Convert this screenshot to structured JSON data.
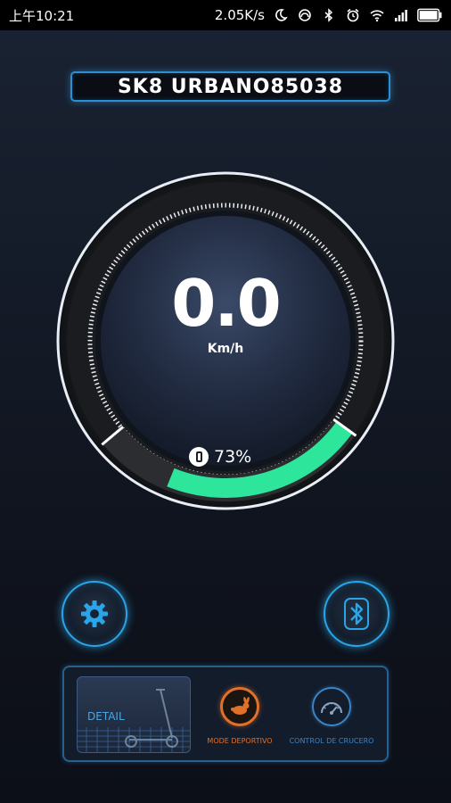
{
  "status_bar": {
    "time": "上午10:21",
    "network_speed": "2.05K/s",
    "icons": [
      "moon-icon",
      "headset-icon",
      "bluetooth-icon",
      "alarm-icon",
      "wifi-icon",
      "signal-icon",
      "battery-icon"
    ]
  },
  "device": {
    "name": "SK8 URBANO85038"
  },
  "speedometer": {
    "speed": "0.0",
    "unit": "Km/h",
    "battery_percent_label": "73%",
    "battery_level": 0.73,
    "gauge_color": "#2ee59c",
    "accent_color": "#2aa5e8"
  },
  "controls": {
    "settings_icon": "gear-icon",
    "bluetooth_icon": "bluetooth-icon"
  },
  "bottom_panel": {
    "detail_label": "DETAIL",
    "modes": [
      {
        "label": "MODE DEPORTIVO",
        "icon": "rabbit-icon",
        "color": "#e0702a"
      },
      {
        "label": "CONTROL DE CRUCERO",
        "icon": "speedometer-icon",
        "color": "#3a84c8"
      }
    ]
  }
}
